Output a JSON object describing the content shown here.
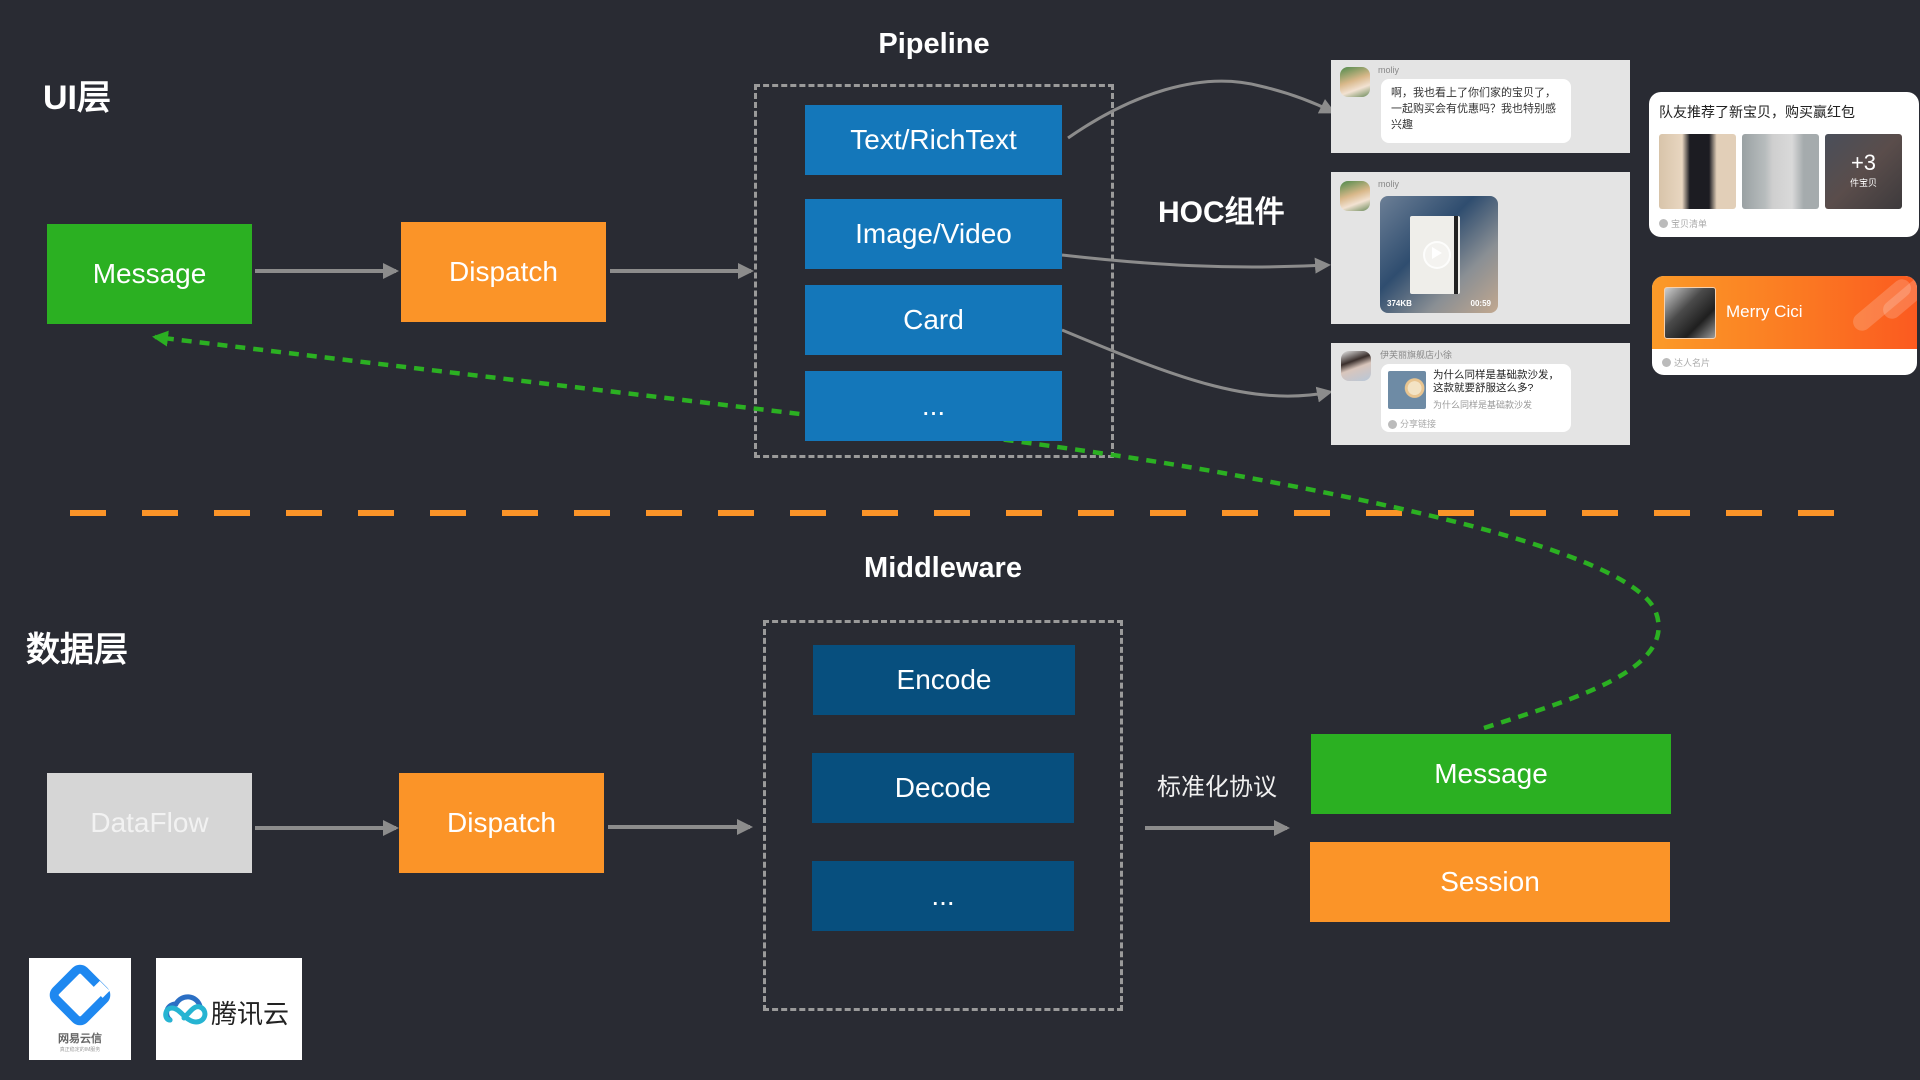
{
  "layers": {
    "ui_title": "UI层",
    "data_title": "数据层"
  },
  "ui_flow": {
    "message": "Message",
    "dispatch": "Dispatch"
  },
  "pipeline": {
    "title": "Pipeline",
    "items": [
      "Text/RichText",
      "Image/Video",
      "Card",
      "..."
    ]
  },
  "hoc_label": "HOC组件",
  "data_flow": {
    "dataflow": "DataFlow",
    "dispatch": "Dispatch"
  },
  "middleware": {
    "title": "Middleware",
    "items": [
      "Encode",
      "Decode",
      "..."
    ]
  },
  "protocol_label": "标准化协议",
  "outputs": {
    "message": "Message",
    "session": "Session"
  },
  "previews": {
    "text_chat": {
      "username": "moliy",
      "text": "啊，我也看上了你们家的宝贝了，一起购买会有优惠吗？我也特别感兴趣"
    },
    "video_chat": {
      "username": "moliy",
      "size": "374KB",
      "duration": "00:59"
    },
    "link_chat": {
      "username": "伊芙丽旗舰店小徐",
      "title": "为什么同样是基础款沙发，这款就要舒服这么多?",
      "subtitle": "为什么同样是基础款沙发",
      "footer": "分享链接"
    },
    "product_card": {
      "title": "队友推荐了新宝贝，购买赢红包",
      "more_count": "+3",
      "more_unit": "件宝贝",
      "footer": "宝贝清单"
    },
    "profile_card": {
      "name": "Merry Cici",
      "footer": "达人名片"
    }
  },
  "logos": {
    "netease": "网易云信",
    "netease_slogan": "真正稳定的IM服务",
    "tencent": "腾讯云"
  },
  "colors": {
    "background": "#292b33",
    "green": "#2bb022",
    "orange": "#fb9428",
    "blue": "#1477ba",
    "navy": "#074f7e",
    "grey_box": "#d6d6d6",
    "arrow": "#8c8c8c",
    "divider": "#fb9428",
    "feedback_dash": "#2bb022"
  }
}
